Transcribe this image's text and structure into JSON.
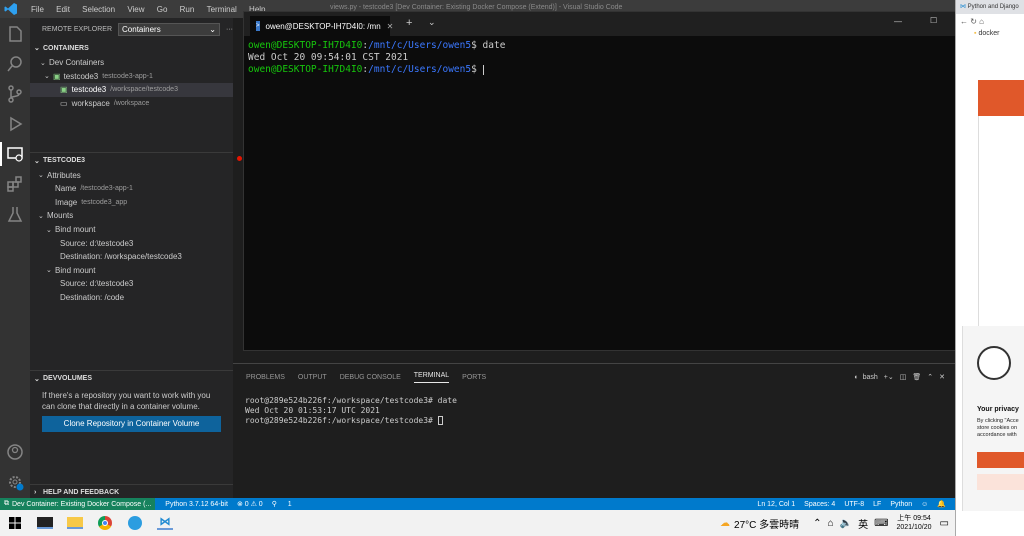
{
  "titlebar": {
    "menu": [
      "File",
      "Edit",
      "Selection",
      "View",
      "Go",
      "Run",
      "Terminal",
      "Help"
    ],
    "title": "views.py - testcode3 [Dev Container: Existing Docker Compose (Extend)] - Visual Studio Code"
  },
  "sidebar": {
    "header": "REMOTE EXPLORER",
    "selected_option": "Containers",
    "containers_title": "CONTAINERS",
    "dev_containers": "Dev Containers",
    "container_name": "testcode3",
    "container_sub": "testcode3-app-1",
    "folder1": "testcode3",
    "folder1_path": "/workspace/testcode3",
    "folder2": "workspace",
    "folder2_path": "/workspace",
    "details_title": "TESTCODE3",
    "attributes": "Attributes",
    "name_label": "Name",
    "name_value": "/testcode3-app-1",
    "image_label": "Image",
    "image_value": "testcode3_app",
    "mounts": "Mounts",
    "bind1": "Bind mount",
    "bind1_source": "Source: d:\\testcode3",
    "bind1_dest": "Destination: /workspace/testcode3",
    "bind2": "Bind mount",
    "bind2_source": "Source: d:\\testcode3",
    "bind2_dest": "Destination: /code",
    "devvolumes_title": "DEVVOLUMES",
    "devvolumes_text": "If there's a repository you want to work with you can clone that directly in a container volume.",
    "clone_button": "Clone Repository in Container Volume",
    "help_title": "HELP AND FEEDBACK"
  },
  "panel": {
    "tabs": [
      "PROBLEMS",
      "OUTPUT",
      "DEBUG CONSOLE",
      "TERMINAL",
      "PORTS"
    ],
    "shell": "bash",
    "lines": [
      "root@289e524b226f:/workspace/testcode3# date",
      "Wed Oct 20 01:53:17 UTC 2021",
      "root@289e524b226f:/workspace/testcode3# "
    ]
  },
  "winterm": {
    "tab_title": "owen@DESKTOP-IH7D4I0: /mn",
    "prompt_user": "owen@DESKTOP-IH7D4I0",
    "prompt_path": "/mnt/c/Users/owen5",
    "command": "date",
    "output": "Wed Oct 20 09:54:01 CST 2021"
  },
  "statusbar": {
    "remote": "Dev Container: Existing Docker Compose (...",
    "python": "Python 3.7.12 64-bit",
    "problems": "⊗ 0 ⚠ 0",
    "ports": "1",
    "position": "Ln 12, Col 1",
    "spaces": "Spaces: 4",
    "encoding": "UTF-8",
    "eol": "LF",
    "language": "Python"
  },
  "taskbar": {
    "weather": "27°C 多雲時晴",
    "ime": "英",
    "time": "上午 09:54",
    "date": "2021/10/20"
  },
  "browser": {
    "tab": "Python and Django",
    "address": "docker",
    "privacy_title": "Your privacy",
    "privacy_text": "By clicking \"Acce store cookies on accordance with"
  }
}
